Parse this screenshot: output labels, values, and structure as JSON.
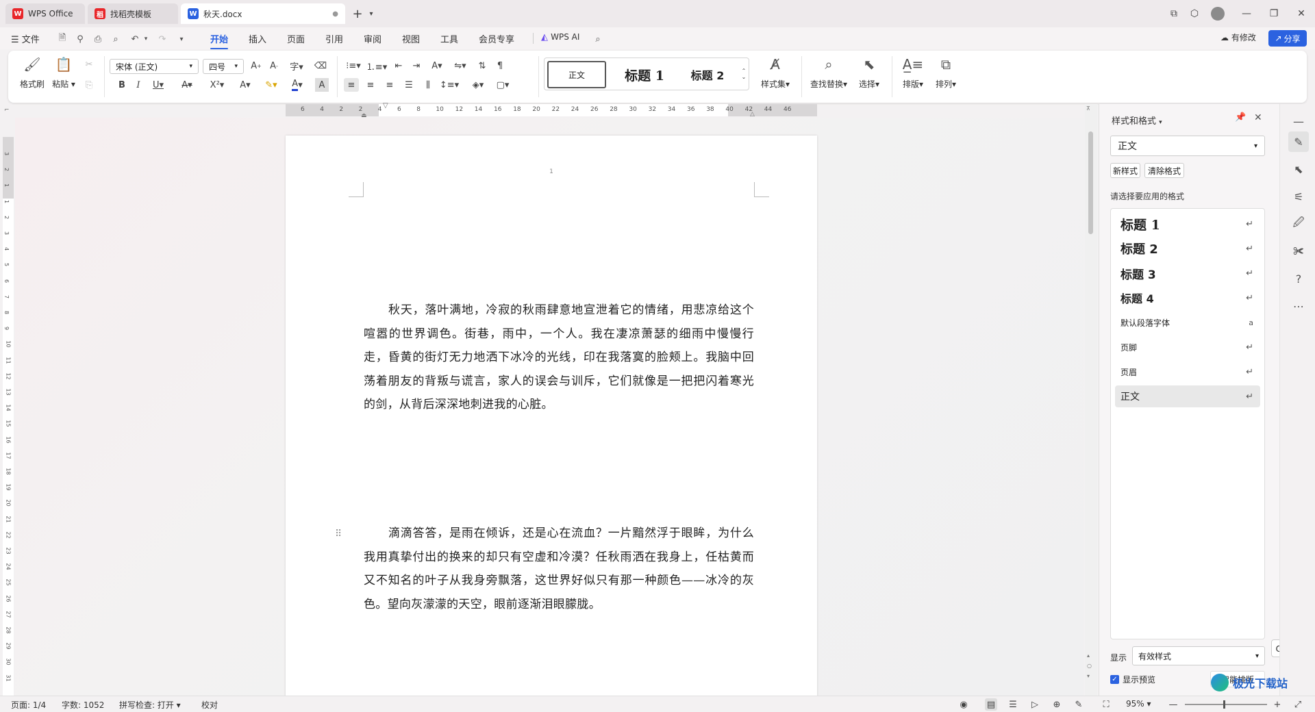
{
  "tabs": [
    {
      "label": "WPS Office",
      "icon": "wps-logo-icon"
    },
    {
      "label": "找稻壳模板",
      "icon": "docer-icon"
    },
    {
      "label": "秋天.docx",
      "icon": "word-doc-icon"
    }
  ],
  "menu": {
    "file": "文件",
    "items": [
      "开始",
      "插入",
      "页面",
      "引用",
      "审阅",
      "视图",
      "工具",
      "会员专享"
    ],
    "wps_ai": "WPS AI",
    "has_changes": "有修改",
    "share": "分享"
  },
  "ribbon": {
    "format_painter": "格式刷",
    "paste": "粘贴",
    "font_name": "宋体 (正文)",
    "font_size": "四号",
    "styles": [
      "正文",
      "标题  1",
      "标题  2"
    ],
    "style_set": "样式集",
    "find_replace": "查找替换",
    "select": "选择",
    "layout": "排版",
    "arrange": "排列"
  },
  "ruler": {
    "h_numbers": [
      "6",
      "4",
      "2",
      "2",
      "4",
      "6",
      "8",
      "10",
      "12",
      "14",
      "16",
      "18",
      "20",
      "22",
      "24",
      "26",
      "28",
      "30",
      "32",
      "34",
      "36",
      "38",
      "40",
      "42",
      "44",
      "46"
    ],
    "v_numbers": [
      "3",
      "2",
      "1",
      "1",
      "2",
      "3",
      "4",
      "5",
      "6",
      "7",
      "8",
      "9",
      "10",
      "11",
      "12",
      "13",
      "14",
      "15",
      "16",
      "17",
      "18",
      "19",
      "20",
      "21",
      "22",
      "23",
      "24",
      "25",
      "26",
      "27",
      "28",
      "29",
      "30",
      "31"
    ]
  },
  "document": {
    "page_number": "1",
    "paragraph1": "秋天，落叶满地，冷寂的秋雨肆意地宣泄着它的情绪，用悲凉给这个喧嚣的世界调色。街巷，雨中，一个人。我在凄凉萧瑟的细雨中慢慢行走，昏黄的街灯无力地洒下冰冷的光线，印在我落寞的脸颊上。我脑中回荡着朋友的背叛与谎言，家人的误会与训斥，它们就像是一把把闪着寒光的剑，从背后深深地刺进我的心脏。",
    "paragraph2": "滴滴答答，是雨在倾诉，还是心在流血？一片黯然浮于眼眸，为什么我用真挚付出的换来的却只有空虚和冷漠？任秋雨洒在我身上，任枯黄而又不知名的叶子从我身旁飘落，这世界好似只有那一种颜色——冰冷的灰色。望向灰濛濛的天空，眼前逐渐泪眼朦胧。"
  },
  "panel": {
    "title": "样式和格式",
    "current_style": "正文",
    "new_style": "新样式",
    "clear_format": "清除格式",
    "prompt": "请选择要应用的格式",
    "styles": [
      "标题  1",
      "标题  2",
      "标题  3",
      "标题 4",
      "默认段落字体",
      "页脚",
      "页眉",
      "正文"
    ],
    "show_label": "显示",
    "show_value": "有效样式",
    "show_preview": "显示预览",
    "smart_layout": "智能排版",
    "ime": "CH ⅅ 简"
  },
  "status": {
    "page": "页面: 1/4",
    "words": "字数: 1052",
    "spell": "拼写检查: 打开",
    "proof": "校对",
    "zoom": "95%"
  },
  "watermark": "极光下载站"
}
